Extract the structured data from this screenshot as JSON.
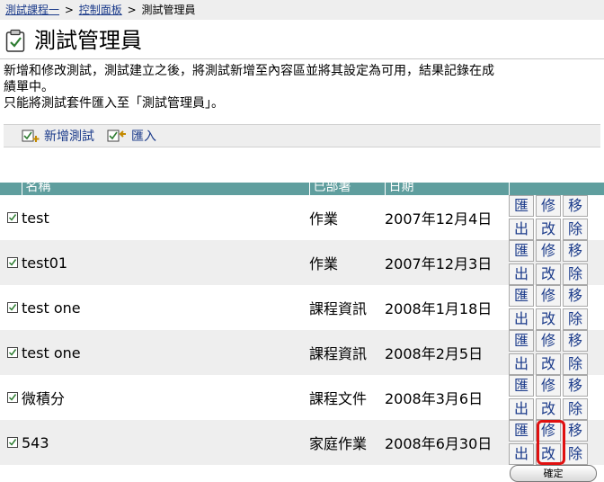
{
  "breadcrumb": {
    "course": "測試課程一",
    "sep1": ">",
    "panel": "控制面板",
    "sep2": ">",
    "current": "測試管理員"
  },
  "page": {
    "title": "測試管理員"
  },
  "description": {
    "line1": "新增和修改測試，測試建立之後，將測試新增至內容區並將其設定為可用，結果記錄在成",
    "line2": "績單中。",
    "line3": "只能將測試套件匯入至「測試管理員」。"
  },
  "actions": {
    "add": "新增測試",
    "import": "匯入"
  },
  "table": {
    "headers": {
      "name": "名稱",
      "deployed": "已部署",
      "date": "日期"
    },
    "rows": [
      {
        "name": "test",
        "deployed": "作業",
        "date": "2007年12月4日",
        "b1": "匯",
        "b2": "修",
        "b3": "移",
        "b4": "出",
        "b5": "改",
        "b6": "除"
      },
      {
        "name": "test01",
        "deployed": "作業",
        "date": "2007年12月3日",
        "b1": "匯",
        "b2": "修",
        "b3": "移",
        "b4": "出",
        "b5": "改",
        "b6": "除"
      },
      {
        "name": "test one",
        "deployed": "課程資訊",
        "date": "2008年1月18日",
        "b1": "匯",
        "b2": "修",
        "b3": "移",
        "b4": "出",
        "b5": "改",
        "b6": "除"
      },
      {
        "name": "test one",
        "deployed": "課程資訊",
        "date": "2008年2月5日",
        "b1": "匯",
        "b2": "修",
        "b3": "移",
        "b4": "出",
        "b5": "改",
        "b6": "除"
      },
      {
        "name": "微積分",
        "deployed": "課程文件",
        "date": "2008年3月6日",
        "b1": "匯",
        "b2": "修",
        "b3": "移",
        "b4": "出",
        "b5": "改",
        "b6": "除"
      },
      {
        "name": "543",
        "deployed": "家庭作業",
        "date": "2008年6月30日",
        "b1": "匯",
        "b2": "修",
        "b3": "移",
        "b4": "出",
        "b5": "改",
        "b6": "除"
      }
    ]
  },
  "footer": {
    "ok": "確定"
  },
  "colors": {
    "header_bg": "#5f9e9e",
    "link": "#1a3a8a",
    "highlight": "#e01010",
    "row_alt": "#eeeeee"
  }
}
